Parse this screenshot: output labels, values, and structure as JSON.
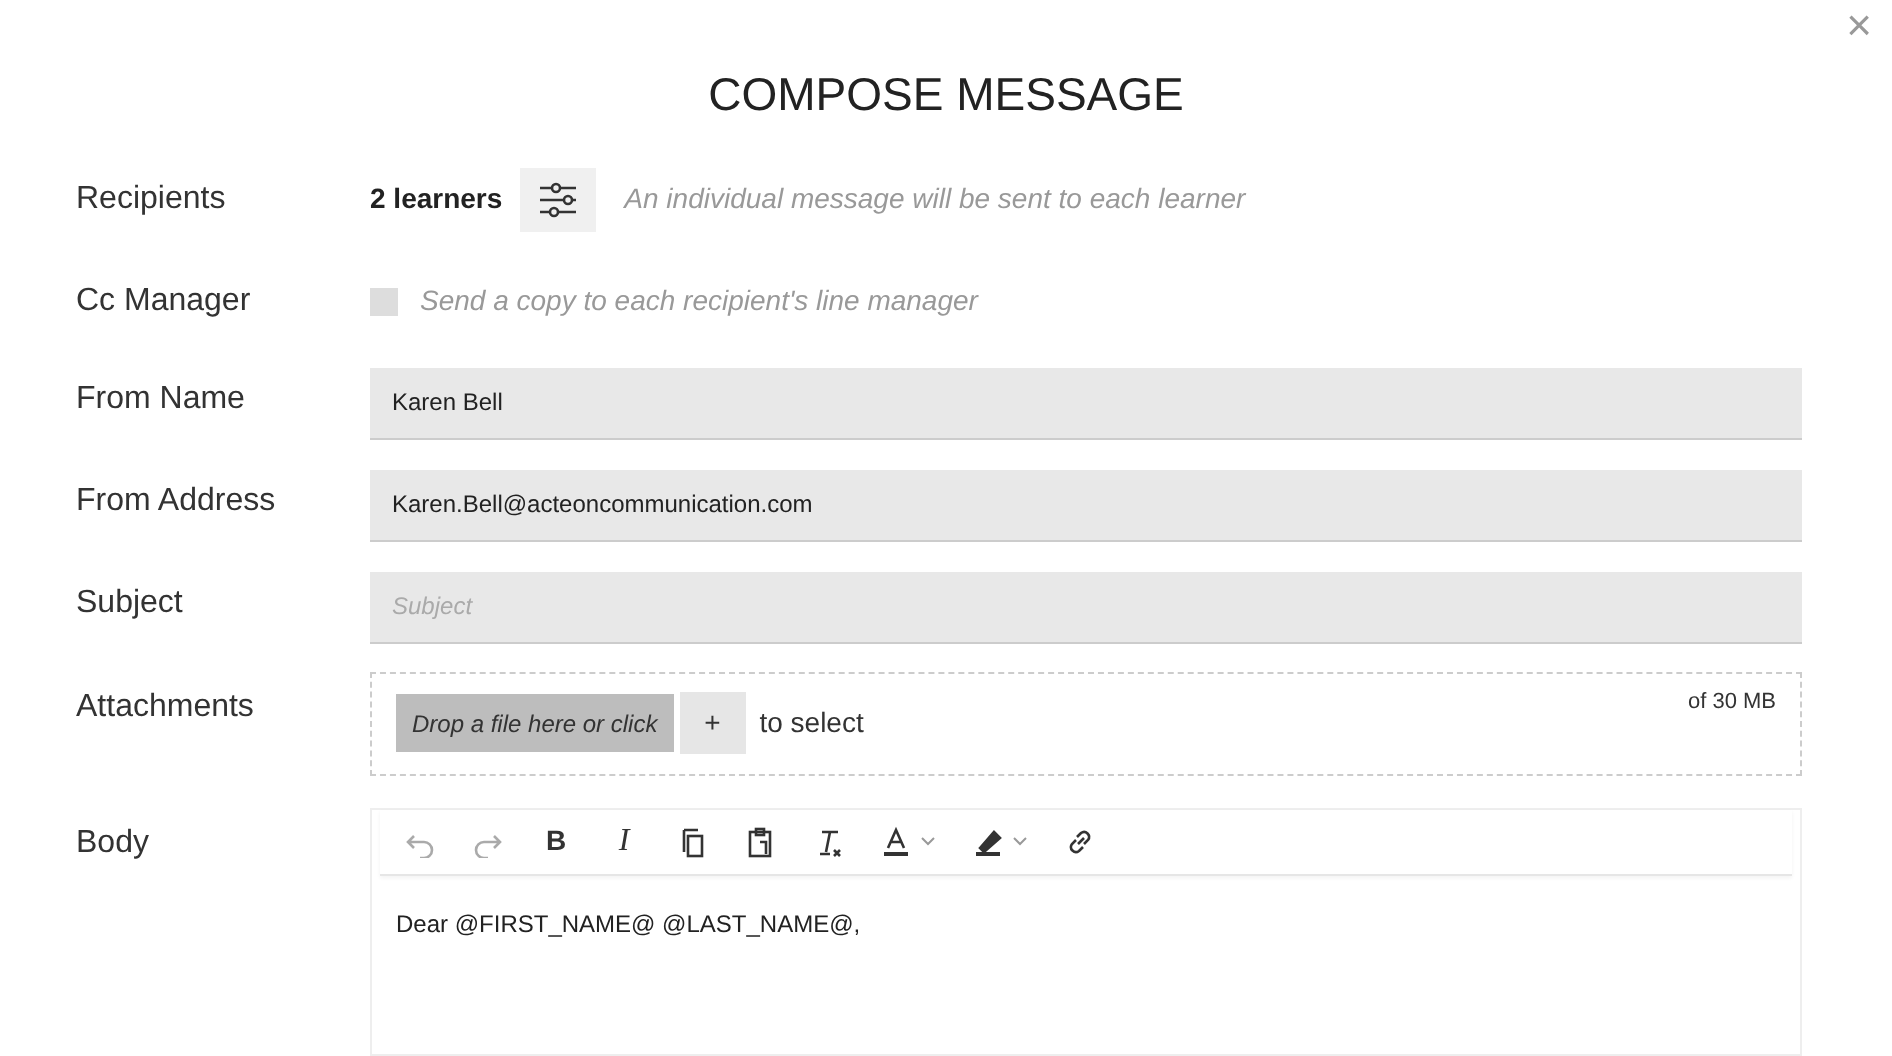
{
  "close": "×",
  "title": "COMPOSE MESSAGE",
  "recipients": {
    "label": "Recipients",
    "count": "2 learners",
    "note": "An individual message will be sent to each learner"
  },
  "cc_manager": {
    "label": "Cc Manager",
    "checked": false,
    "text": "Send a copy to each recipient's line manager"
  },
  "from_name": {
    "label": "From Name",
    "value": "Karen Bell"
  },
  "from_address": {
    "label": "From Address",
    "value": "Karen.Bell@acteoncommunication.com"
  },
  "subject": {
    "label": "Subject",
    "placeholder": "Subject"
  },
  "attachments": {
    "label": "Attachments",
    "drop": "Drop a file here or click",
    "plus": "+",
    "select": "to select",
    "limit": "of 30 MB"
  },
  "body": {
    "label": "Body",
    "toolbar": [
      {
        "kind": "undo",
        "disabled": true
      },
      {
        "kind": "redo",
        "disabled": true
      },
      {
        "kind": "bold",
        "text": "B",
        "disabled": false
      },
      {
        "kind": "italic",
        "text": "I",
        "disabled": false
      },
      {
        "kind": "copy",
        "disabled": false
      },
      {
        "kind": "paste",
        "disabled": false
      },
      {
        "kind": "clear-format",
        "disabled": false
      },
      {
        "kind": "text-color",
        "disabled": false
      },
      {
        "kind": "highlight",
        "disabled": false
      },
      {
        "kind": "link",
        "disabled": false
      }
    ],
    "text": "Dear @FIRST_NAME@ @LAST_NAME@,"
  }
}
